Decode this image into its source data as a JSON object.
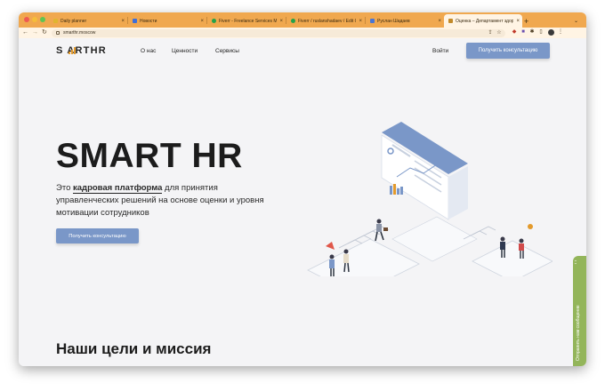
{
  "browser": {
    "tabs": [
      {
        "title": "Daily planner",
        "favicon_color": "#e0b530"
      },
      {
        "title": "Новости",
        "favicon_color": "#3f6fd8"
      },
      {
        "title": "Fiverr - Freelance Services Mar",
        "favicon_color": "#25a24a"
      },
      {
        "title": "Fiverr / ruslanshadaev / Edit Gi",
        "favicon_color": "#25a24a"
      },
      {
        "title": "Руслан Шадаев",
        "favicon_color": "#4a76d4"
      },
      {
        "title": "Оценка – Департамент здор",
        "favicon_color": "#c28a2a",
        "active": true
      }
    ],
    "new_tab_label": "+",
    "url": "smarthr.moscow"
  },
  "site": {
    "logo": "S  ARTHR",
    "nav": [
      "О нас",
      "Ценности",
      "Сервисы"
    ],
    "login": "Войти",
    "cta_top": "Получить консультацию"
  },
  "hero": {
    "title": "SMART HR",
    "text_before": "Это ",
    "text_bold": "кадровая платформа",
    "text_after": " для принятия управленческих решений на основе оценки и уровня мотивации сотрудников",
    "cta": "Получить консультацию"
  },
  "section": {
    "title": "Наши цели и миссия"
  },
  "feedback": {
    "label": "Отправить нам сообщение",
    "top": "‹ ›"
  },
  "colors": {
    "tab_bar": "#f0a84f",
    "accent_button": "#7a97c8",
    "logo_accent": "#e39a2c",
    "feedback_green": "#93b55a"
  }
}
